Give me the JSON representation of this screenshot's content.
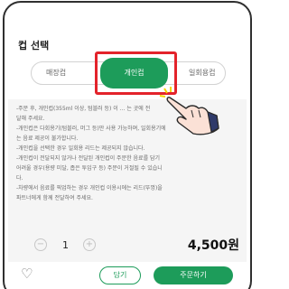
{
  "header": {
    "title": "컵 선택"
  },
  "cup_tabs": [
    {
      "label": "매장컵",
      "selected": false
    },
    {
      "label": "개인컵",
      "selected": true
    },
    {
      "label": "일회용컵",
      "selected": false
    }
  ],
  "notice": {
    "lines": [
      "-주문 후, 개인컵(355ml 이상, 텀블러 등) 이 ... 는 곳에 전",
      "달해 주세요.",
      "-개인컵은 다회용기(텀블러, 머그 등)만 사용 가능하며, 일회용기에",
      "는 음료 제공이 불가합니다.",
      "-개인컵을 선택한 경우 일회용 리드는 제공되지 않습니다.",
      "-개인컵이 전달되지 않거나 전달된 개인컵이 주문한 음료를 담기",
      "어려울 경우(용량 미달, 좁은 투입구 등) 주문이 거절될 수 있습니",
      "다.",
      "-차량에서 음료를 픽업하는 경우 개인컵 이용시에는 리드(뚜껑)을",
      "파트너에게 함께 전달하여 주세요."
    ]
  },
  "order": {
    "minus_symbol": "−",
    "plus_symbol": "+",
    "quantity": "1",
    "price": "4,500원"
  },
  "actions": {
    "favorite_icon": "heart-outline-icon",
    "favorite_symbol": "♡",
    "save_label": "담기",
    "order_label": "주문하기"
  },
  "colors": {
    "accent_green": "#1d9c5a",
    "highlight_red": "#e3232b"
  }
}
